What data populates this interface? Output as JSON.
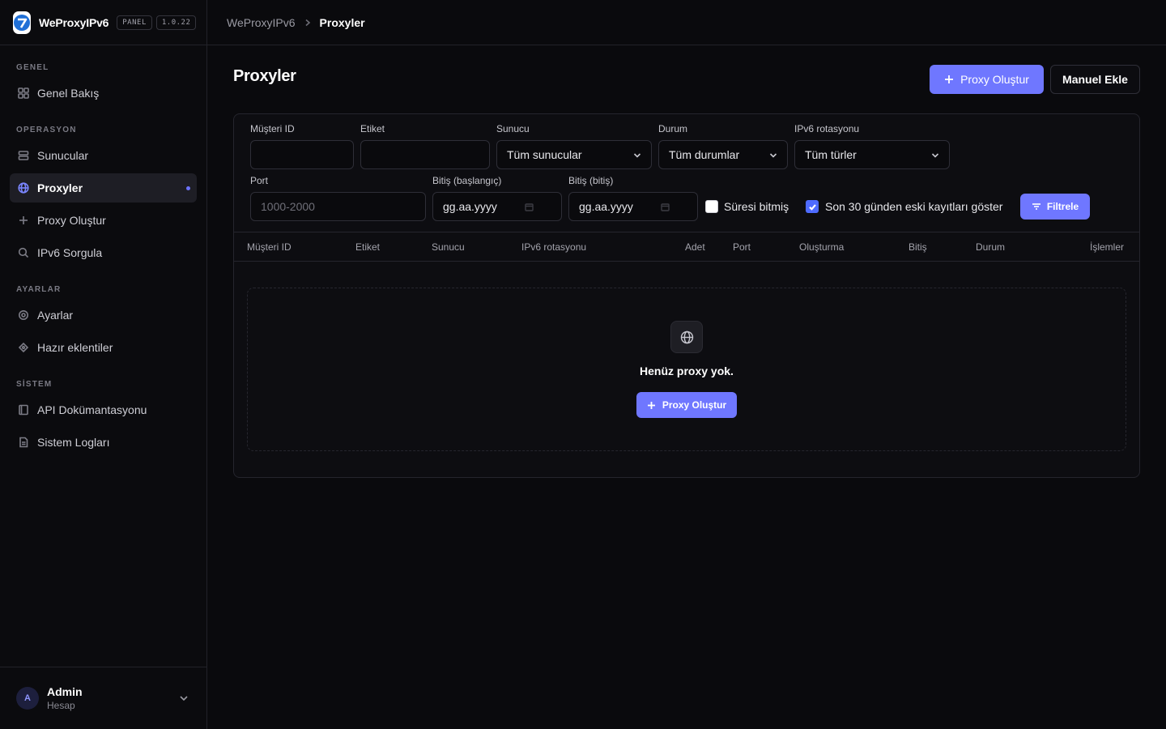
{
  "app": {
    "name": "WeProxyIPv6",
    "badge_panel": "PANEL",
    "version": "1.0.22"
  },
  "breadcrumb": {
    "root": "WeProxyIPv6",
    "current": "Proxyler"
  },
  "sidebar": {
    "sections": [
      {
        "title": "GENEL",
        "items": [
          {
            "label": "Genel Bakış",
            "icon": "grid-icon"
          }
        ]
      },
      {
        "title": "OPERASYON",
        "items": [
          {
            "label": "Sunucular",
            "icon": "server-icon"
          },
          {
            "label": "Proxyler",
            "icon": "globe-icon",
            "active": true
          },
          {
            "label": "Proxy Oluştur",
            "icon": "plus-icon"
          },
          {
            "label": "IPv6 Sorgula",
            "icon": "search-icon"
          }
        ]
      },
      {
        "title": "AYARLAR",
        "items": [
          {
            "label": "Ayarlar",
            "icon": "gear-icon"
          },
          {
            "label": "Hazır eklentiler",
            "icon": "puzzle-icon"
          }
        ]
      },
      {
        "title": "SİSTEM",
        "items": [
          {
            "label": "API Dokümantasyonu",
            "icon": "book-icon"
          },
          {
            "label": "Sistem Logları",
            "icon": "file-icon"
          }
        ]
      }
    ]
  },
  "user": {
    "initial": "A",
    "name": "Admin",
    "role": "Hesap"
  },
  "page": {
    "title": "Proxyler",
    "create_button": "Proxy Oluştur",
    "manual_button": "Manuel Ekle"
  },
  "filters": {
    "customer_id": {
      "label": "Müşteri ID",
      "value": ""
    },
    "tag": {
      "label": "Etiket",
      "value": ""
    },
    "server": {
      "label": "Sunucu",
      "value": "Tüm sunucular"
    },
    "status": {
      "label": "Durum",
      "value": "Tüm durumlar"
    },
    "rotation": {
      "label": "IPv6 rotasyonu",
      "value": "Tüm türler"
    },
    "port": {
      "label": "Port",
      "placeholder": "1000-2000"
    },
    "end_start": {
      "label": "Bitiş (başlangıç)",
      "value": "gg.aa.yyyy"
    },
    "end_end": {
      "label": "Bitiş (bitiş)",
      "value": "gg.aa.yyyy"
    },
    "expired": {
      "label": "Süresi bitmiş",
      "checked": false
    },
    "show_old": {
      "label": "Son 30 günden eski kayıtları göster",
      "checked": true
    },
    "filter_button": "Filtrele"
  },
  "table": {
    "columns": [
      "Müşteri ID",
      "Etiket",
      "Sunucu",
      "IPv6 rotasyonu",
      "Adet",
      "Port",
      "Oluşturma",
      "Bitiş",
      "Durum",
      "İşlemler"
    ],
    "rows": []
  },
  "empty_state": {
    "text": "Henüz proxy yok.",
    "button": "Proxy Oluştur"
  },
  "colors": {
    "accent": "#6f77ff",
    "background": "#0a0a0d",
    "checkbox_checked": "#4e6bff"
  }
}
